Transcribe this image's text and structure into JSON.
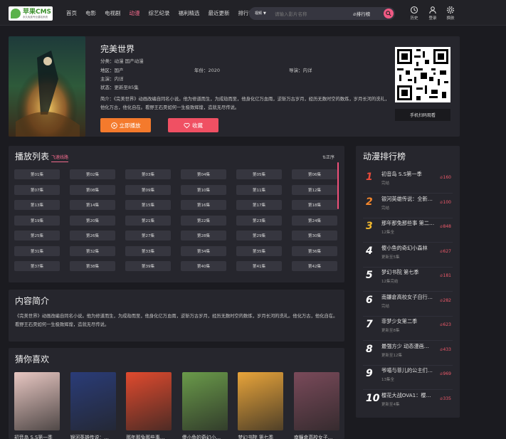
{
  "header": {
    "logo_main": "苹果CMS",
    "logo_sub": "永久免费专业建站系统",
    "nav": [
      "首页",
      "电影",
      "电视剧",
      "动漫",
      "综艺纪录",
      "福利精选",
      "最近更新",
      "排行榜"
    ],
    "search_type": "视频",
    "search_placeholder": "请输入影片名称",
    "search_rank": "排行榜",
    "history": "历史",
    "login": "登录",
    "skin": "换肤"
  },
  "detail": {
    "title": "完美世界",
    "category_label": "分类：",
    "category_value": "动漫  国产动漫",
    "region_label": "地区：",
    "region_value": "国产",
    "year_label": "年份：",
    "year_value": "2020",
    "director_label": "导演：",
    "director_value": "内详",
    "actor_label": "主演：",
    "actor_value": "内详",
    "status_label": "状态：",
    "status_value": "更新至85集",
    "intro": "简介：《完美世界》动画改编自同名小说。他为修道而生，为成劫而至，他身化亿万血雨，逆斩万古岁月，经历无数时空的数炼，岁月长河的洗礼，他化万古，他化自在。看野王石昊如何一生极致辉煌，造就无尽传说。",
    "play_btn": "立即播放",
    "fav_btn": "收藏",
    "qr_caption": "手机扫码观看"
  },
  "playlist": {
    "title": "播放列表",
    "tab": "飞速线路",
    "sort": "正序",
    "episodes": [
      "第01集",
      "第02集",
      "第03集",
      "第04集",
      "第05集",
      "第06集",
      "第07集",
      "第08集",
      "第09集",
      "第10集",
      "第11集",
      "第12集",
      "第13集",
      "第14集",
      "第15集",
      "第16集",
      "第17集",
      "第18集",
      "第19集",
      "第20集",
      "第21集",
      "第22集",
      "第23集",
      "第24集",
      "第25集",
      "第26集",
      "第27集",
      "第28集",
      "第29集",
      "第30集",
      "第31集",
      "第32集",
      "第33集",
      "第34集",
      "第35集",
      "第36集",
      "第37集",
      "第38集",
      "第39集",
      "第40集",
      "第41集",
      "第42集"
    ]
  },
  "synopsis": {
    "title": "内容简介",
    "text": "《完美世界》动画改编自同名小说。他为修道而生，为成劫而至，他身化亿万血雨，逆斩万古岁月，经历无数时空的数炼，岁月长河的洗礼。他化万古，他化自在。看野王石昊如何一生极致辉煌，造就无尽传说。"
  },
  "recommend": {
    "title": "猜你喜欢",
    "items": [
      {
        "name": "初音岛 S.S第一季",
        "color": "#e8c7c2"
      },
      {
        "name": "银河英雄传说：…",
        "color": "#2a3c78"
      },
      {
        "name": "那年那兔那些事…",
        "color": "#e04a2e"
      },
      {
        "name": "傻小鱼的奇幻小…",
        "color": "#6a9a4a"
      },
      {
        "name": "梦幻书院 第七季",
        "color": "#e8a43a"
      },
      {
        "name": "南鐮倉高校女子…",
        "color": "#7a4a5a"
      }
    ]
  },
  "rank": {
    "title": "动漫排行榜",
    "items": [
      {
        "num": "1",
        "name": "初音岛 S.S第一季",
        "status": "完结",
        "hot": "160"
      },
      {
        "num": "2",
        "name": "银河英雄传说：全新…",
        "status": "完结",
        "hot": "100"
      },
      {
        "num": "3",
        "name": "那年那兔那些事 第二…",
        "status": "12集全",
        "hot": "848"
      },
      {
        "num": "4",
        "name": "傻小鱼的奇幻小森林",
        "status": "更新至5集",
        "hot": "627"
      },
      {
        "num": "5",
        "name": "梦幻书院 第七季",
        "status": "12集完结",
        "hot": "181"
      },
      {
        "num": "6",
        "name": "南鐮倉高校女子自行…",
        "status": "完结",
        "hot": "282"
      },
      {
        "num": "7",
        "name": "菲梦少女第二季",
        "status": "更新至8集",
        "hot": "623"
      },
      {
        "num": "8",
        "name": "最强方少 动态漫画…",
        "status": "更新至12集",
        "hot": "433"
      },
      {
        "num": "9",
        "name": "爷喵与菲儿的公主们…",
        "status": "13集全",
        "hot": "969"
      },
      {
        "num": "10",
        "name": "樱花大战OVA1：樱…",
        "status": "更新至4集",
        "hot": "335"
      }
    ]
  }
}
